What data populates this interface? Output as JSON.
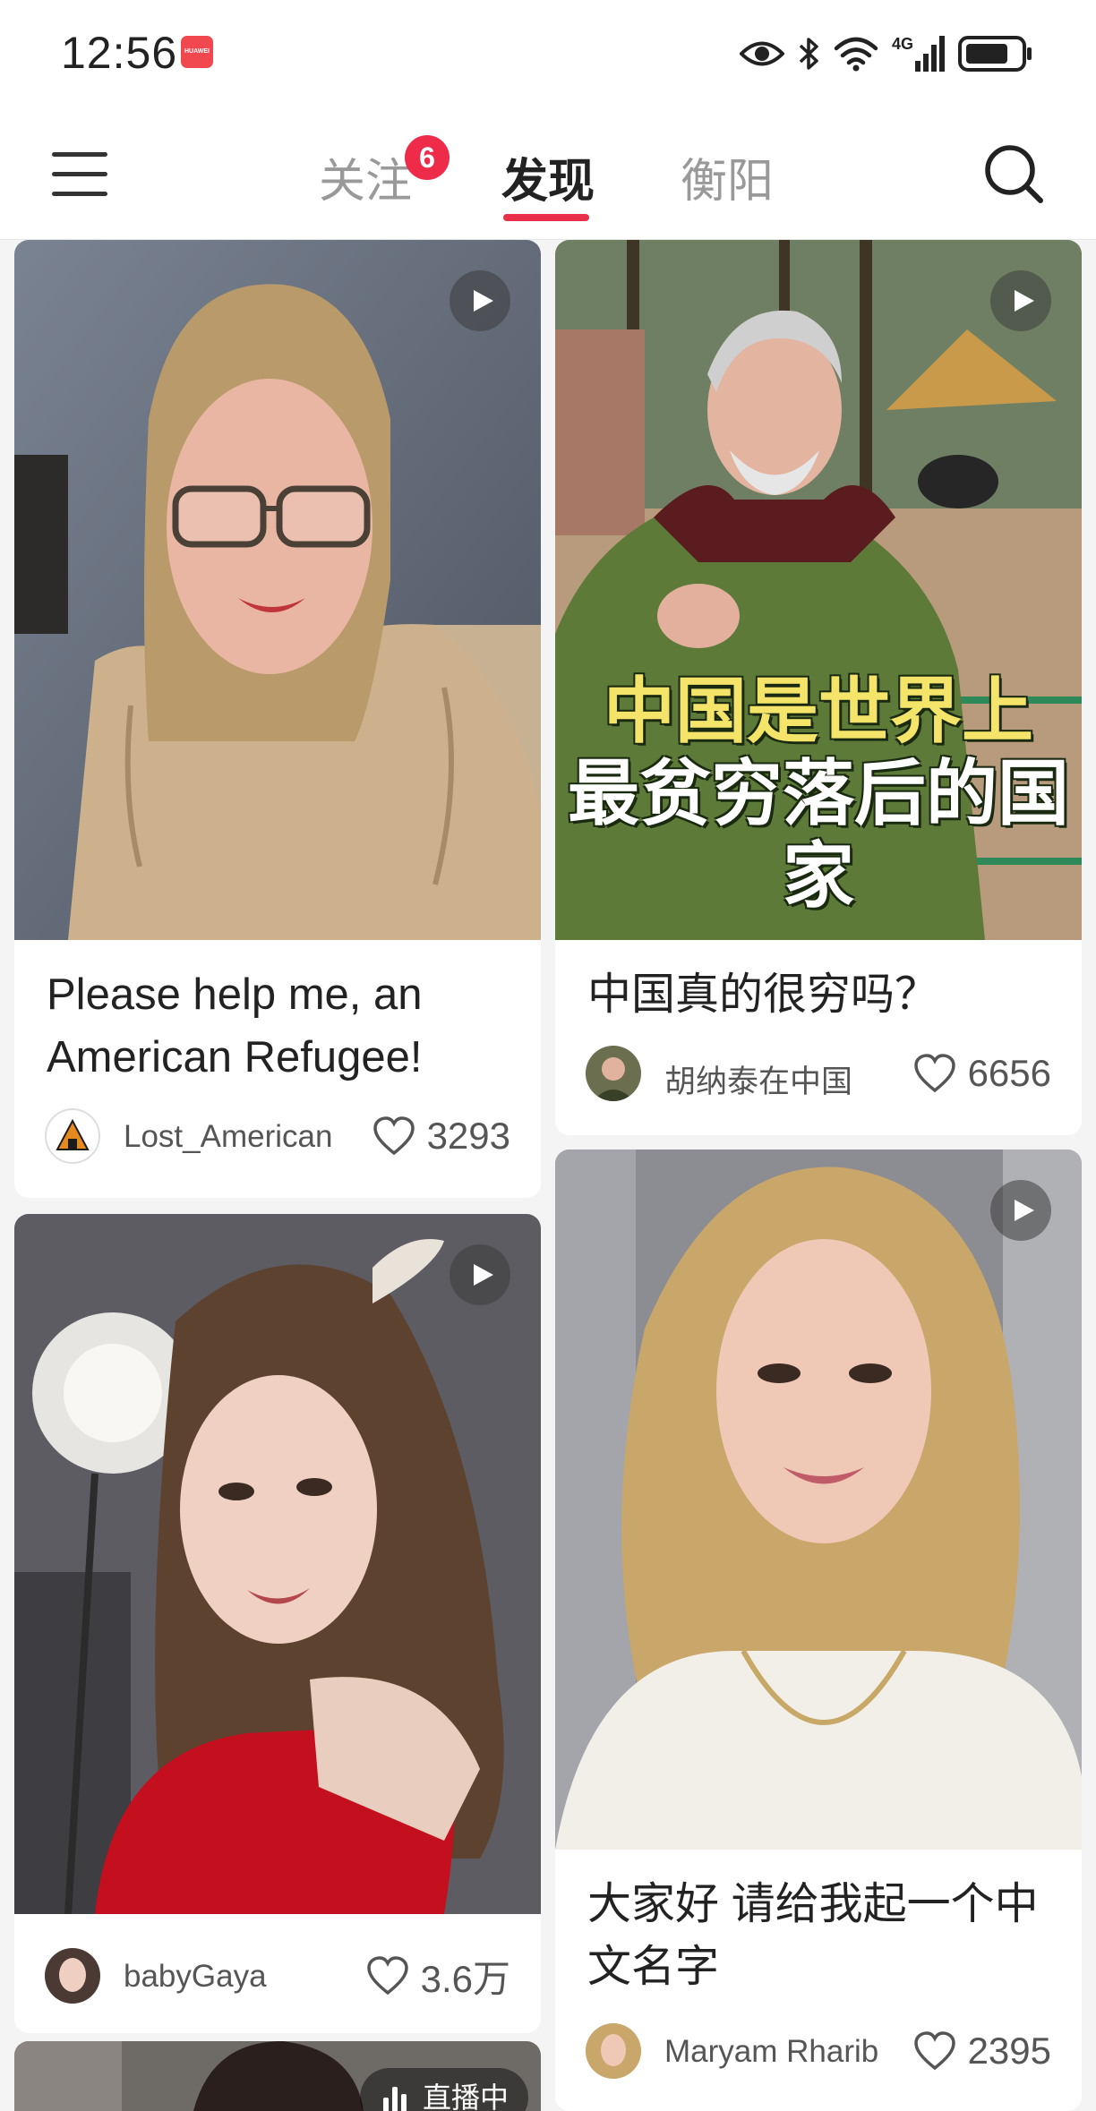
{
  "status_bar": {
    "time": "12:56",
    "app_badge_text": "HUAWEI",
    "network": "4G",
    "battery_level": 0.8
  },
  "nav": {
    "tabs": [
      {
        "label": "关注",
        "badge": "6"
      },
      {
        "label": "发现"
      },
      {
        "label": "衡阳"
      }
    ],
    "active_tab": "发现",
    "menu_icon": "hamburger-menu-icon",
    "search_icon": "search-icon"
  },
  "feed": [
    {
      "title": "Please help me, an American Refugee!",
      "author": "Lost_American",
      "likes": "3293",
      "has_video": true
    },
    {
      "title": "中国真的很穷吗？",
      "overlay_line1": "中国是世界上",
      "overlay_line2": "最贫穷落后的国家",
      "author": "胡纳泰在中国",
      "likes": "6656",
      "has_video": true
    },
    {
      "author": "babyGaya",
      "likes": "3.6万",
      "has_video": true
    },
    {
      "title": "大家好 请给我起一个中文名字",
      "author": "Maryam Rharib",
      "likes": "2395",
      "has_video": true
    },
    {
      "live_label": "直播中"
    }
  ],
  "colors": {
    "accent": "#e8304a",
    "badge": "#ee2c4a"
  }
}
